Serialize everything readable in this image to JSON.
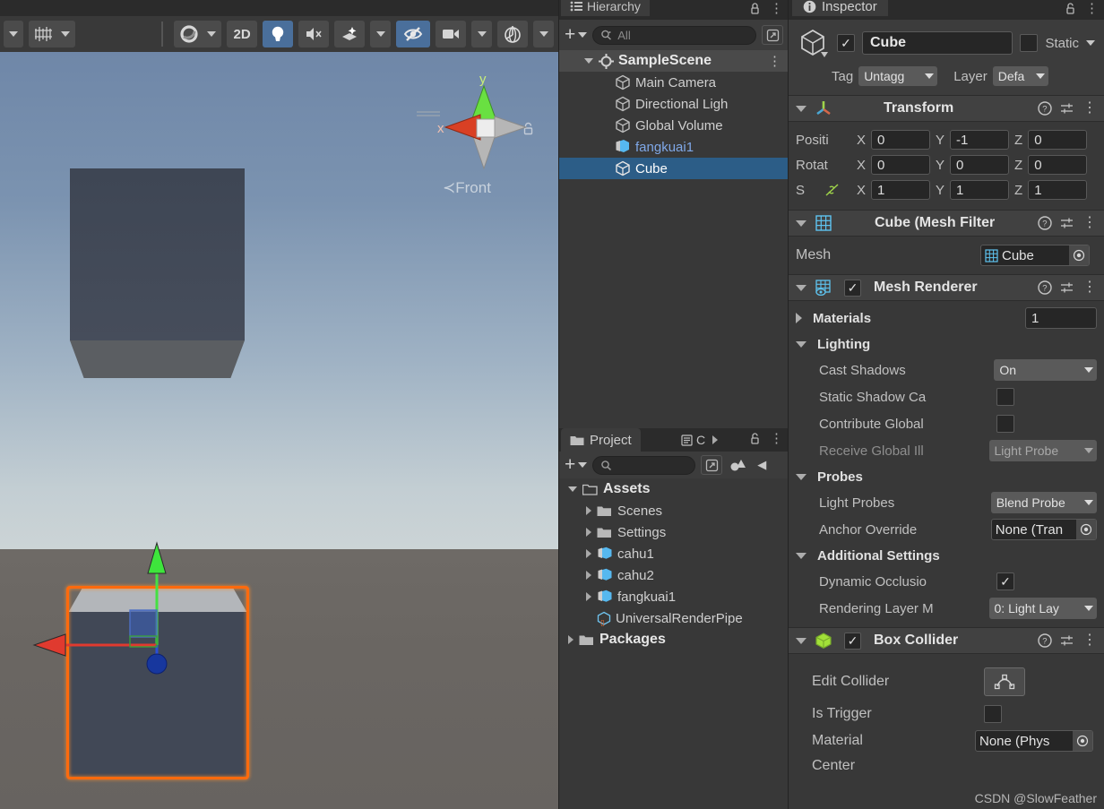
{
  "scene_view": {
    "toolbar": [
      {
        "name": "tool-handle-dropdown",
        "icon": "caret-down"
      },
      {
        "name": "snap-increment",
        "icon": "grid-snap",
        "caret": true
      },
      {
        "name": "draw-mode-dropdown",
        "icon": "shaded-sphere",
        "caret": true
      },
      {
        "name": "2d-toggle",
        "label": "2D"
      },
      {
        "name": "scene-lighting-toggle",
        "icon": "lightbulb",
        "active": true
      },
      {
        "name": "scene-audio-toggle",
        "icon": "speaker-mute"
      },
      {
        "name": "fx-dropdown",
        "icon": "effects",
        "caret": true
      },
      {
        "name": "hidden-objects-toggle",
        "icon": "eye-slash",
        "active": true
      },
      {
        "name": "camera-dropdown",
        "icon": "camera",
        "caret": true
      },
      {
        "name": "gizmos-dropdown",
        "icon": "gizmo-globe",
        "caret": true
      }
    ],
    "gizmo": {
      "x_label": "x",
      "y_label": "y",
      "view_label": "Front",
      "lock": "lock-icon"
    },
    "objects": [
      "fangkuai1-cube",
      "Cube-selected"
    ]
  },
  "hierarchy": {
    "tab_label": "Hierarchy",
    "search_placeholder": "All",
    "add_label": "+",
    "scene_name": "SampleScene",
    "items": [
      {
        "label": "Main Camera",
        "type": "gameobject",
        "selected": false,
        "prefab": false
      },
      {
        "label": "Directional Ligh",
        "type": "gameobject",
        "selected": false,
        "prefab": false
      },
      {
        "label": "Global Volume",
        "type": "gameobject",
        "selected": false,
        "prefab": false
      },
      {
        "label": "fangkuai1",
        "type": "prefab",
        "selected": false,
        "prefab": true
      },
      {
        "label": "Cube",
        "type": "gameobject",
        "selected": true,
        "prefab": false
      }
    ]
  },
  "project": {
    "tab_label": "Project",
    "tab2_label": "C",
    "search_placeholder": "",
    "items": [
      {
        "label": "Assets",
        "depth": 0,
        "type": "folder-open",
        "expanded": true,
        "bold": true
      },
      {
        "label": "Scenes",
        "depth": 1,
        "type": "folder",
        "expanded": false,
        "bold": false
      },
      {
        "label": "Settings",
        "depth": 1,
        "type": "folder",
        "expanded": false,
        "bold": false
      },
      {
        "label": "cahu1",
        "depth": 1,
        "type": "prefab",
        "expanded": false,
        "bold": false
      },
      {
        "label": "cahu2",
        "depth": 1,
        "type": "prefab",
        "expanded": false,
        "bold": false
      },
      {
        "label": "fangkuai1",
        "depth": 1,
        "type": "prefab",
        "expanded": false,
        "bold": false
      },
      {
        "label": "UniversalRenderPipe",
        "depth": 1,
        "type": "asset",
        "expanded": null,
        "bold": false
      },
      {
        "label": "Packages",
        "depth": 0,
        "type": "folder",
        "expanded": false,
        "bold": true
      }
    ]
  },
  "inspector": {
    "tab_label": "Inspector",
    "object": {
      "enabled": true,
      "name": "Cube",
      "static_label": "Static",
      "static_checked": false,
      "tag_label": "Tag",
      "tag_value": "Untagg",
      "layer_label": "Layer",
      "layer_value": "Defa"
    },
    "transform": {
      "title": "Transform",
      "position_label": "Positi",
      "rotation_label": "Rotat",
      "scale_label": "S",
      "axis_x": "X",
      "axis_y": "Y",
      "axis_z": "Z",
      "position": {
        "x": "0",
        "y": "-1",
        "z": "0"
      },
      "rotation": {
        "x": "0",
        "y": "0",
        "z": "0"
      },
      "scale": {
        "x": "1",
        "y": "1",
        "z": "1"
      }
    },
    "mesh_filter": {
      "title": "Cube (Mesh Filter",
      "mesh_label": "Mesh",
      "mesh_value": "Cube"
    },
    "mesh_renderer": {
      "title": "Mesh Renderer",
      "enabled": true,
      "materials_label": "Materials",
      "materials_count": "1",
      "lighting_label": "Lighting",
      "cast_shadows_label": "Cast Shadows",
      "cast_shadows_value": "On",
      "static_shadow_label": "Static Shadow Ca",
      "static_shadow_checked": false,
      "contribute_global_label": "Contribute Global",
      "contribute_global_checked": false,
      "receive_global_label": "Receive Global Ill",
      "receive_global_value": "Light Probe",
      "probes_label": "Probes",
      "light_probes_label": "Light Probes",
      "light_probes_value": "Blend Probe",
      "anchor_override_label": "Anchor Override",
      "anchor_override_value": "None (Tran",
      "additional_settings_label": "Additional Settings",
      "dynamic_occlusion_label": "Dynamic Occlusio",
      "dynamic_occlusion_checked": true,
      "rendering_layer_label": "Rendering Layer M",
      "rendering_layer_value": "0: Light Lay"
    },
    "box_collider": {
      "title": "Box Collider",
      "enabled": true,
      "edit_collider_label": "Edit Collider",
      "is_trigger_label": "Is Trigger",
      "is_trigger_checked": false,
      "material_label": "Material",
      "material_value": "None (Phys",
      "center_label": "Center"
    }
  },
  "watermark": "CSDN @SlowFeather",
  "colors": {
    "selection_blue": "#2c5d87",
    "accent_orange": "#ff6a0d",
    "toolbar_active": "#4a6f9b",
    "prefab_blue": "#7fa8e8",
    "panel_bg": "#383838"
  }
}
